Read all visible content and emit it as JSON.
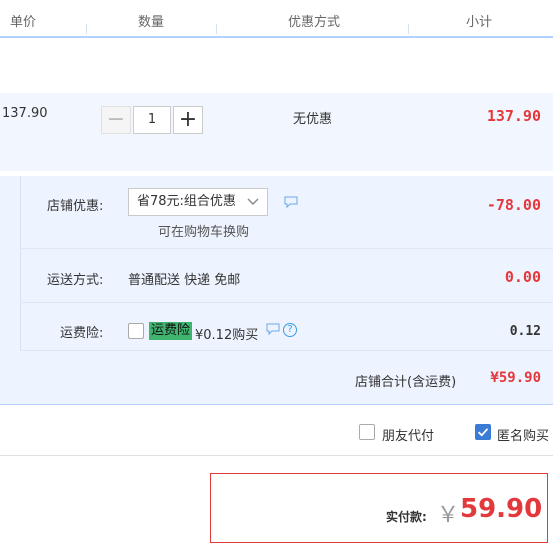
{
  "header": {
    "col_unit_price": "单价",
    "col_quantity": "数量",
    "col_promotion": "优惠方式",
    "col_subtotal": "小计"
  },
  "item": {
    "unit_price": "137.90",
    "quantity": "1",
    "minus": "−",
    "plus": "+",
    "promotion": "无优惠",
    "subtotal": "137.90"
  },
  "store": {
    "discount_label": "店铺优惠:",
    "discount_selected": "省78元:组合优惠",
    "discount_hint": "可在购物车换购",
    "discount_value": "-78.00",
    "shipping_label": "运送方式:",
    "shipping_text": "普通配送 快递 免邮",
    "shipping_value": "0.00",
    "insurance_label": "运费险:",
    "insurance_tag": "运费险",
    "insurance_price": "¥0.12购买",
    "insurance_value": "0.12",
    "total_label": "店铺合计(含运费)",
    "total_value": "¥59.90"
  },
  "options": {
    "friend_pay": "朋友代付",
    "anonymous": "匿名购买"
  },
  "payment": {
    "label": "实付款:",
    "currency": "￥",
    "amount": "59.90"
  },
  "colors": {
    "accent_red": "#e4393c",
    "header_line": "#b2d1ff",
    "insurance_tag_bg": "#3fb46f",
    "check_blue": "#3a7bd5"
  },
  "icons": [
    "chat-icon",
    "help-icon",
    "chevron-down-icon",
    "check-icon"
  ]
}
